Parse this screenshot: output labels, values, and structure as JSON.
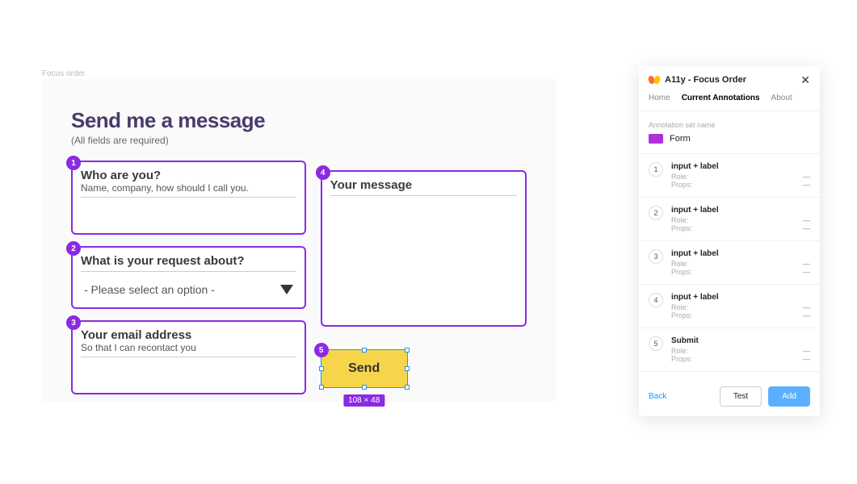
{
  "frame_label": "Focus order",
  "form": {
    "title": "Send me a message",
    "subtitle": "(All fields are required)",
    "fields": [
      {
        "badge": "1",
        "label": "Who are you?",
        "desc": "Name, company, how should I call you."
      },
      {
        "badge": "2",
        "label": "What is your request about?",
        "select_placeholder": "- Please select an option -"
      },
      {
        "badge": "3",
        "label": "Your email address",
        "desc": "So that I can recontact you"
      },
      {
        "badge": "4",
        "label": "Your message"
      }
    ],
    "send": {
      "badge": "5",
      "label": "Send",
      "dimension": "108 × 48"
    }
  },
  "panel": {
    "title": "A11y - Focus Order",
    "tabs": [
      "Home",
      "Current Annotations",
      "About"
    ],
    "active_tab": 1,
    "set_label": "Annotation set name",
    "set_name": "Form",
    "annotations": [
      {
        "num": "1",
        "label": "input + label",
        "role": "Role:",
        "props": "Props:"
      },
      {
        "num": "2",
        "label": "input + label",
        "role": "Role:",
        "props": "Props:"
      },
      {
        "num": "3",
        "label": "input + label",
        "role": "Role:",
        "props": "Props:"
      },
      {
        "num": "4",
        "label": "input + label",
        "role": "Role:",
        "props": "Props:"
      },
      {
        "num": "5",
        "label": "Submit",
        "role": "Role:",
        "props": "Props:"
      }
    ],
    "dash": "—",
    "back": "Back",
    "test": "Test",
    "add": "Add"
  }
}
